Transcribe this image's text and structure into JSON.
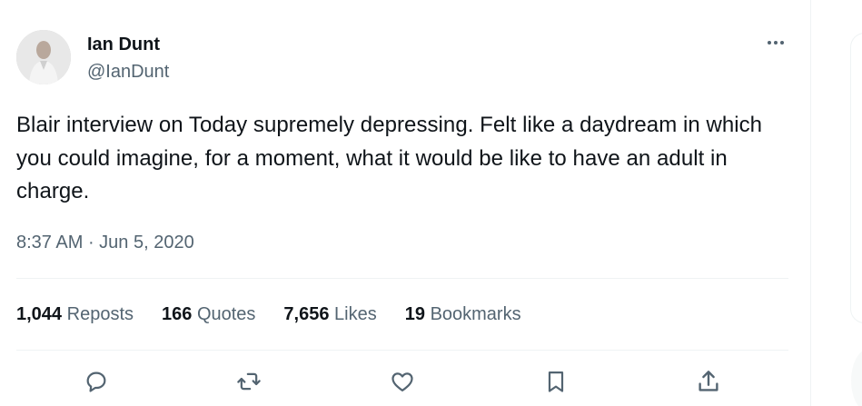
{
  "author": {
    "display_name": "Ian Dunt",
    "handle": "@IanDunt"
  },
  "tweet": {
    "text": "Blair interview on Today supremely depressing. Felt like a daydream in which you could imagine, for a moment, what it would be like to have an adult in charge.",
    "time": "8:37 AM",
    "separator": " · ",
    "date": "Jun 5, 2020"
  },
  "stats": [
    {
      "count": "1,044",
      "label": "Reposts"
    },
    {
      "count": "166",
      "label": "Quotes"
    },
    {
      "count": "7,656",
      "label": "Likes"
    },
    {
      "count": "19",
      "label": "Bookmarks"
    }
  ],
  "icons": {
    "more": "more-horizontal-icon",
    "reply": "reply-icon",
    "repost": "repost-icon",
    "like": "heart-icon",
    "bookmark": "bookmark-icon",
    "share": "share-icon"
  },
  "colors": {
    "text_primary": "#0f1419",
    "text_secondary": "#536471",
    "divider": "#eff3f4"
  }
}
